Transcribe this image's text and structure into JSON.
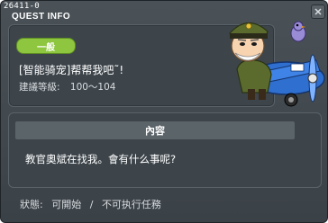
{
  "window": {
    "quest_id": "26411-0",
    "title": "QUEST INFO"
  },
  "quest": {
    "badge": "一般",
    "name": "[智能骑宠]帮帮我吧˜!",
    "level_label": "建議等級:",
    "level_range": "100～104"
  },
  "content": {
    "header": "內容",
    "text": "教官奧斌在找我。會有什么事呢?"
  },
  "status": {
    "label": "狀態:",
    "startable": "可開始",
    "separator": "/",
    "not_executable": "不可执行任務"
  },
  "colors": {
    "window_bg": "#43494e",
    "panel_bg": "#3d454b",
    "badge_green": "#8ec63f",
    "text_white": "#ffffff"
  },
  "icons": {
    "close": "close-icon",
    "npc": "npc-pilot-illustration"
  }
}
